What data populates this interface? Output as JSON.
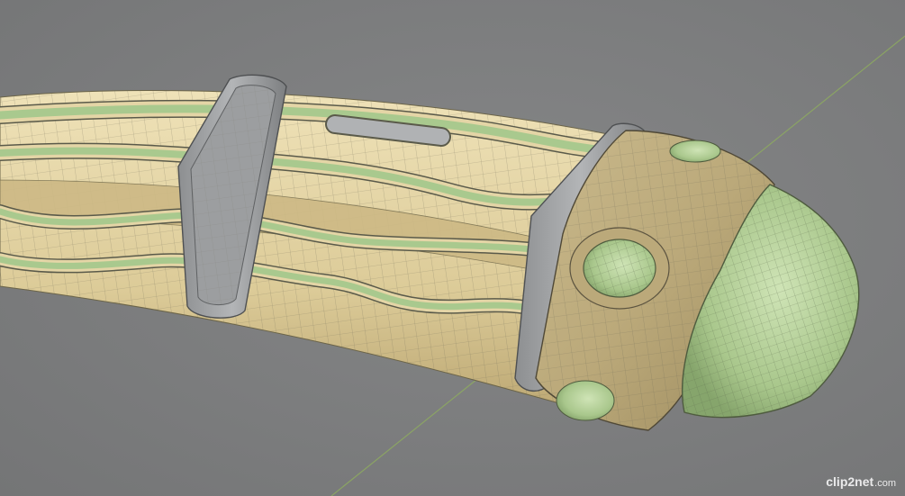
{
  "image": {
    "subject": "cable-bundle-3d-model",
    "colors": {
      "background": "#7c7d7e",
      "tube_tan": "#e2d2a3",
      "tube_tan_dark": "#c2ad78",
      "wire_green": "#a9c98e",
      "wire_green_light": "#c6dfae",
      "clamp_gray": "#a7a9ab",
      "clamp_gray_dark": "#6d6f71",
      "wire_outline": "#5a5a4a",
      "axis_line": "#8fae5e"
    }
  },
  "watermark": {
    "brand": "clip2net",
    "tld": ".com"
  }
}
